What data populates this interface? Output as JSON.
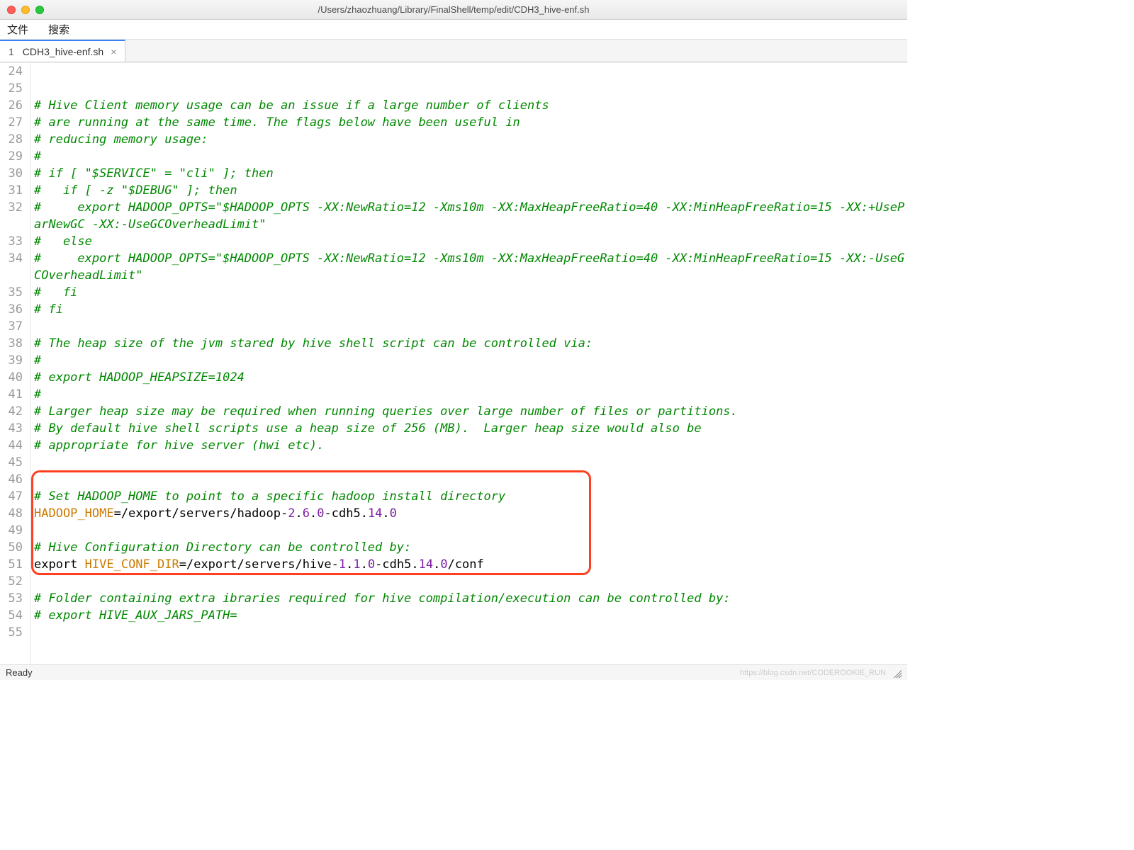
{
  "window": {
    "title": "/Users/zhaozhuang/Library/FinalShell/temp/edit/CDH3_hive-enf.sh"
  },
  "menu": {
    "file": "文件",
    "search": "搜索"
  },
  "tab": {
    "index": "1",
    "name": "CDH3_hive-enf.sh",
    "close": "×"
  },
  "lines": [
    {
      "n": "24",
      "segments": []
    },
    {
      "n": "25",
      "segments": []
    },
    {
      "n": "26",
      "segments": [
        {
          "cls": "comment",
          "t": "# Hive Client memory usage can be an issue if a large number of clients"
        }
      ]
    },
    {
      "n": "27",
      "segments": [
        {
          "cls": "comment",
          "t": "# are running at the same time. The flags below have been useful in"
        }
      ]
    },
    {
      "n": "28",
      "segments": [
        {
          "cls": "comment",
          "t": "# reducing memory usage:"
        }
      ]
    },
    {
      "n": "29",
      "segments": [
        {
          "cls": "comment",
          "t": "#"
        }
      ]
    },
    {
      "n": "30",
      "segments": [
        {
          "cls": "comment",
          "t": "# if [ \"$SERVICE\" = \"cli\" ]; then"
        }
      ]
    },
    {
      "n": "31",
      "segments": [
        {
          "cls": "comment",
          "t": "#   if [ -z \"$DEBUG\" ]; then"
        }
      ]
    },
    {
      "n": "32",
      "wrap": true,
      "segments": [
        {
          "cls": "comment",
          "t": "#     export HADOOP_OPTS=\"$HADOOP_OPTS -XX:NewRatio=12 -Xms10m -XX:MaxHeapFreeRatio=40 -XX:MinHeapFreeRatio=15 -XX:+UseParNewGC -XX:-UseGCOverheadLimit\""
        }
      ]
    },
    {
      "n": "33",
      "segments": [
        {
          "cls": "comment",
          "t": "#   else"
        }
      ]
    },
    {
      "n": "34",
      "wrap": true,
      "segments": [
        {
          "cls": "comment",
          "t": "#     export HADOOP_OPTS=\"$HADOOP_OPTS -XX:NewRatio=12 -Xms10m -XX:MaxHeapFreeRatio=40 -XX:MinHeapFreeRatio=15 -XX:-UseGCOverheadLimit\""
        }
      ]
    },
    {
      "n": "35",
      "segments": [
        {
          "cls": "comment",
          "t": "#   fi"
        }
      ]
    },
    {
      "n": "36",
      "segments": [
        {
          "cls": "comment",
          "t": "# fi"
        }
      ]
    },
    {
      "n": "37",
      "segments": []
    },
    {
      "n": "38",
      "segments": [
        {
          "cls": "comment",
          "t": "# The heap size of the jvm stared by hive shell script can be controlled via:"
        }
      ]
    },
    {
      "n": "39",
      "segments": [
        {
          "cls": "comment",
          "t": "#"
        }
      ]
    },
    {
      "n": "40",
      "segments": [
        {
          "cls": "comment",
          "t": "# export HADOOP_HEAPSIZE=1024"
        }
      ]
    },
    {
      "n": "41",
      "segments": [
        {
          "cls": "comment",
          "t": "#"
        }
      ]
    },
    {
      "n": "42",
      "segments": [
        {
          "cls": "comment",
          "t": "# Larger heap size may be required when running queries over large number of files or partitions."
        }
      ]
    },
    {
      "n": "43",
      "segments": [
        {
          "cls": "comment",
          "t": "# By default hive shell scripts use a heap size of 256 (MB).  Larger heap size would also be"
        }
      ]
    },
    {
      "n": "44",
      "segments": [
        {
          "cls": "comment",
          "t": "# appropriate for hive server (hwi etc)."
        }
      ]
    },
    {
      "n": "45",
      "segments": []
    },
    {
      "n": "46",
      "segments": []
    },
    {
      "n": "47",
      "segments": [
        {
          "cls": "comment",
          "t": "# Set HADOOP_HOME to point to a specific hadoop install directory"
        }
      ]
    },
    {
      "n": "48",
      "segments": [
        {
          "cls": "ident",
          "t": "HADOOP_HOME"
        },
        {
          "cls": "op",
          "t": "="
        },
        {
          "cls": "path",
          "t": "/export/servers/hadoop-"
        },
        {
          "cls": "num",
          "t": "2"
        },
        {
          "cls": "op",
          "t": "."
        },
        {
          "cls": "num",
          "t": "6"
        },
        {
          "cls": "op",
          "t": "."
        },
        {
          "cls": "num",
          "t": "0"
        },
        {
          "cls": "path",
          "t": "-cdh5"
        },
        {
          "cls": "op",
          "t": "."
        },
        {
          "cls": "num",
          "t": "14"
        },
        {
          "cls": "op",
          "t": "."
        },
        {
          "cls": "num",
          "t": "0"
        }
      ]
    },
    {
      "n": "49",
      "segments": []
    },
    {
      "n": "50",
      "segments": [
        {
          "cls": "comment",
          "t": "# Hive Configuration Directory can be controlled by:"
        }
      ]
    },
    {
      "n": "51",
      "segments": [
        {
          "cls": "keyword",
          "t": "export "
        },
        {
          "cls": "ident",
          "t": "HIVE_CONF_DIR"
        },
        {
          "cls": "op",
          "t": "="
        },
        {
          "cls": "path",
          "t": "/export/servers/hive-"
        },
        {
          "cls": "num",
          "t": "1"
        },
        {
          "cls": "op",
          "t": "."
        },
        {
          "cls": "num",
          "t": "1"
        },
        {
          "cls": "op",
          "t": "."
        },
        {
          "cls": "num",
          "t": "0"
        },
        {
          "cls": "path",
          "t": "-cdh5"
        },
        {
          "cls": "op",
          "t": "."
        },
        {
          "cls": "num",
          "t": "14"
        },
        {
          "cls": "op",
          "t": "."
        },
        {
          "cls": "num",
          "t": "0"
        },
        {
          "cls": "path",
          "t": "/conf"
        }
      ]
    },
    {
      "n": "52",
      "segments": []
    },
    {
      "n": "53",
      "segments": [
        {
          "cls": "comment",
          "t": "# Folder containing extra ibraries required for hive compilation/execution can be controlled by:"
        }
      ]
    },
    {
      "n": "54",
      "segments": [
        {
          "cls": "comment",
          "t": "# export HIVE_AUX_JARS_PATH="
        }
      ]
    },
    {
      "n": "55",
      "segments": []
    }
  ],
  "highlight": {
    "start_line": "46",
    "end_line": "51"
  },
  "status": {
    "text": "Ready",
    "watermark": "https://blog.csdn.net/CODEROOKIE_RUN"
  }
}
